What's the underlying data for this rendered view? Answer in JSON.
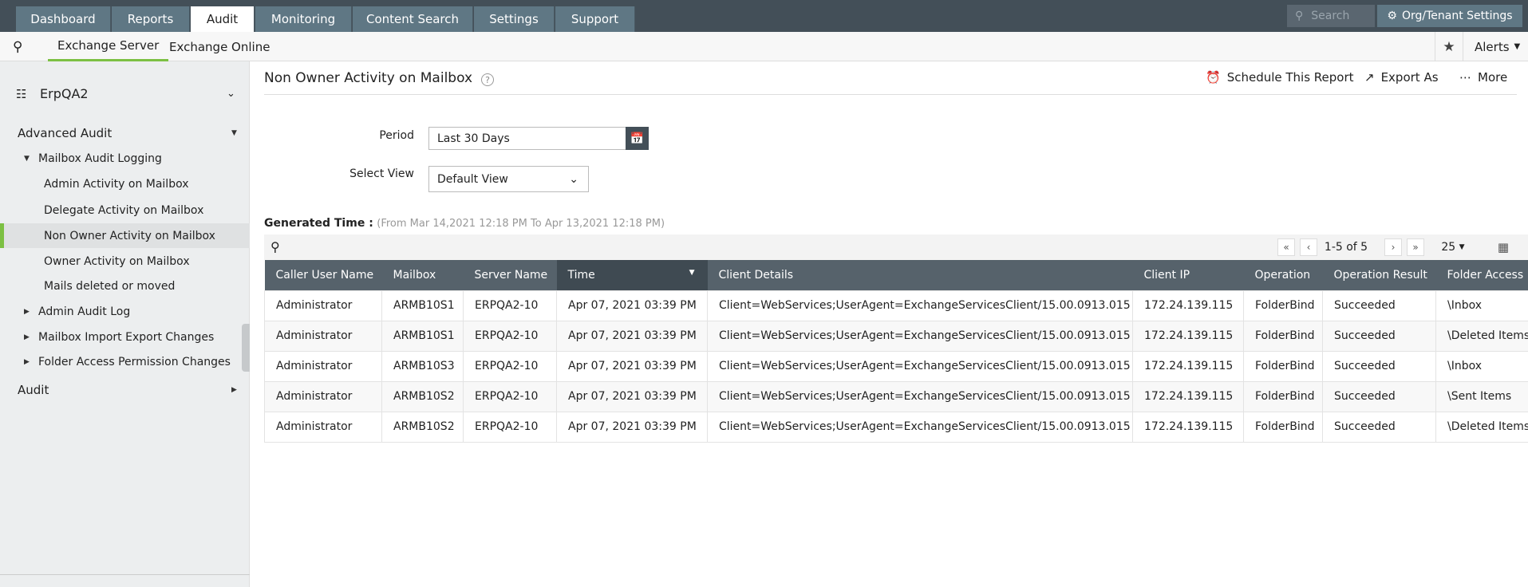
{
  "top_tabs": [
    "Dashboard",
    "Reports",
    "Audit",
    "Monitoring",
    "Content Search",
    "Settings",
    "Support"
  ],
  "active_tab": "Audit",
  "search_placeholder": "Search",
  "org_settings": "Org/Tenant Settings",
  "subnav": [
    "Exchange Server",
    "Exchange Online"
  ],
  "alerts": "Alerts",
  "sidebar": {
    "org": "ErpQA2",
    "items": [
      "Advanced Audit",
      "Mailbox Audit Logging",
      "Admin Activity on Mailbox",
      "Delegate Activity on Mailbox",
      "Non Owner Activity on Mailbox",
      "Owner Activity on Mailbox",
      "Mails deleted or moved",
      "Admin Audit Log",
      "Mailbox Import Export Changes",
      "Folder Access Permission Changes",
      "Audit"
    ],
    "selected": "Non Owner Activity on Mailbox"
  },
  "report": {
    "title": "Non Owner Activity on Mailbox",
    "schedule": "Schedule This Report",
    "export": "Export As",
    "more": "More",
    "period_label": "Period",
    "period_value": "Last 30 Days",
    "view_label": "Select View",
    "view_value": "Default View",
    "generated_label": "Generated Time :",
    "generated_range": "(From Mar 14,2021 12:18 PM To Apr 13,2021 12:18 PM)",
    "pagination": "1-5 of 5",
    "page_size": "25"
  },
  "table": {
    "columns": [
      "Caller User Name",
      "Mailbox",
      "Server Name",
      "Time",
      "Client Details",
      "Client IP",
      "Operation",
      "Operation Result",
      "Folder Access"
    ],
    "sorted_column": "Time",
    "rows": [
      [
        "Administrator",
        "ARMB10S1",
        "ERPQA2-10",
        "Apr 07, 2021 03:39 PM",
        "Client=WebServices;UserAgent=ExchangeServicesClient/15.00.0913.015",
        "172.24.139.115",
        "FolderBind",
        "Succeeded",
        "\\Inbox"
      ],
      [
        "Administrator",
        "ARMB10S1",
        "ERPQA2-10",
        "Apr 07, 2021 03:39 PM",
        "Client=WebServices;UserAgent=ExchangeServicesClient/15.00.0913.015",
        "172.24.139.115",
        "FolderBind",
        "Succeeded",
        "\\Deleted Items"
      ],
      [
        "Administrator",
        "ARMB10S3",
        "ERPQA2-10",
        "Apr 07, 2021 03:39 PM",
        "Client=WebServices;UserAgent=ExchangeServicesClient/15.00.0913.015",
        "172.24.139.115",
        "FolderBind",
        "Succeeded",
        "\\Inbox"
      ],
      [
        "Administrator",
        "ARMB10S2",
        "ERPQA2-10",
        "Apr 07, 2021 03:39 PM",
        "Client=WebServices;UserAgent=ExchangeServicesClient/15.00.0913.015",
        "172.24.139.115",
        "FolderBind",
        "Succeeded",
        "\\Sent Items"
      ],
      [
        "Administrator",
        "ARMB10S2",
        "ERPQA2-10",
        "Apr 07, 2021 03:39 PM",
        "Client=WebServices;UserAgent=ExchangeServicesClient/15.00.0913.015",
        "172.24.139.115",
        "FolderBind",
        "Succeeded",
        "\\Deleted Items"
      ]
    ]
  },
  "colors": {
    "topbar": "#434f58",
    "tab": "#5f7784",
    "accent": "#7cc043",
    "table_header": "#56626b"
  }
}
